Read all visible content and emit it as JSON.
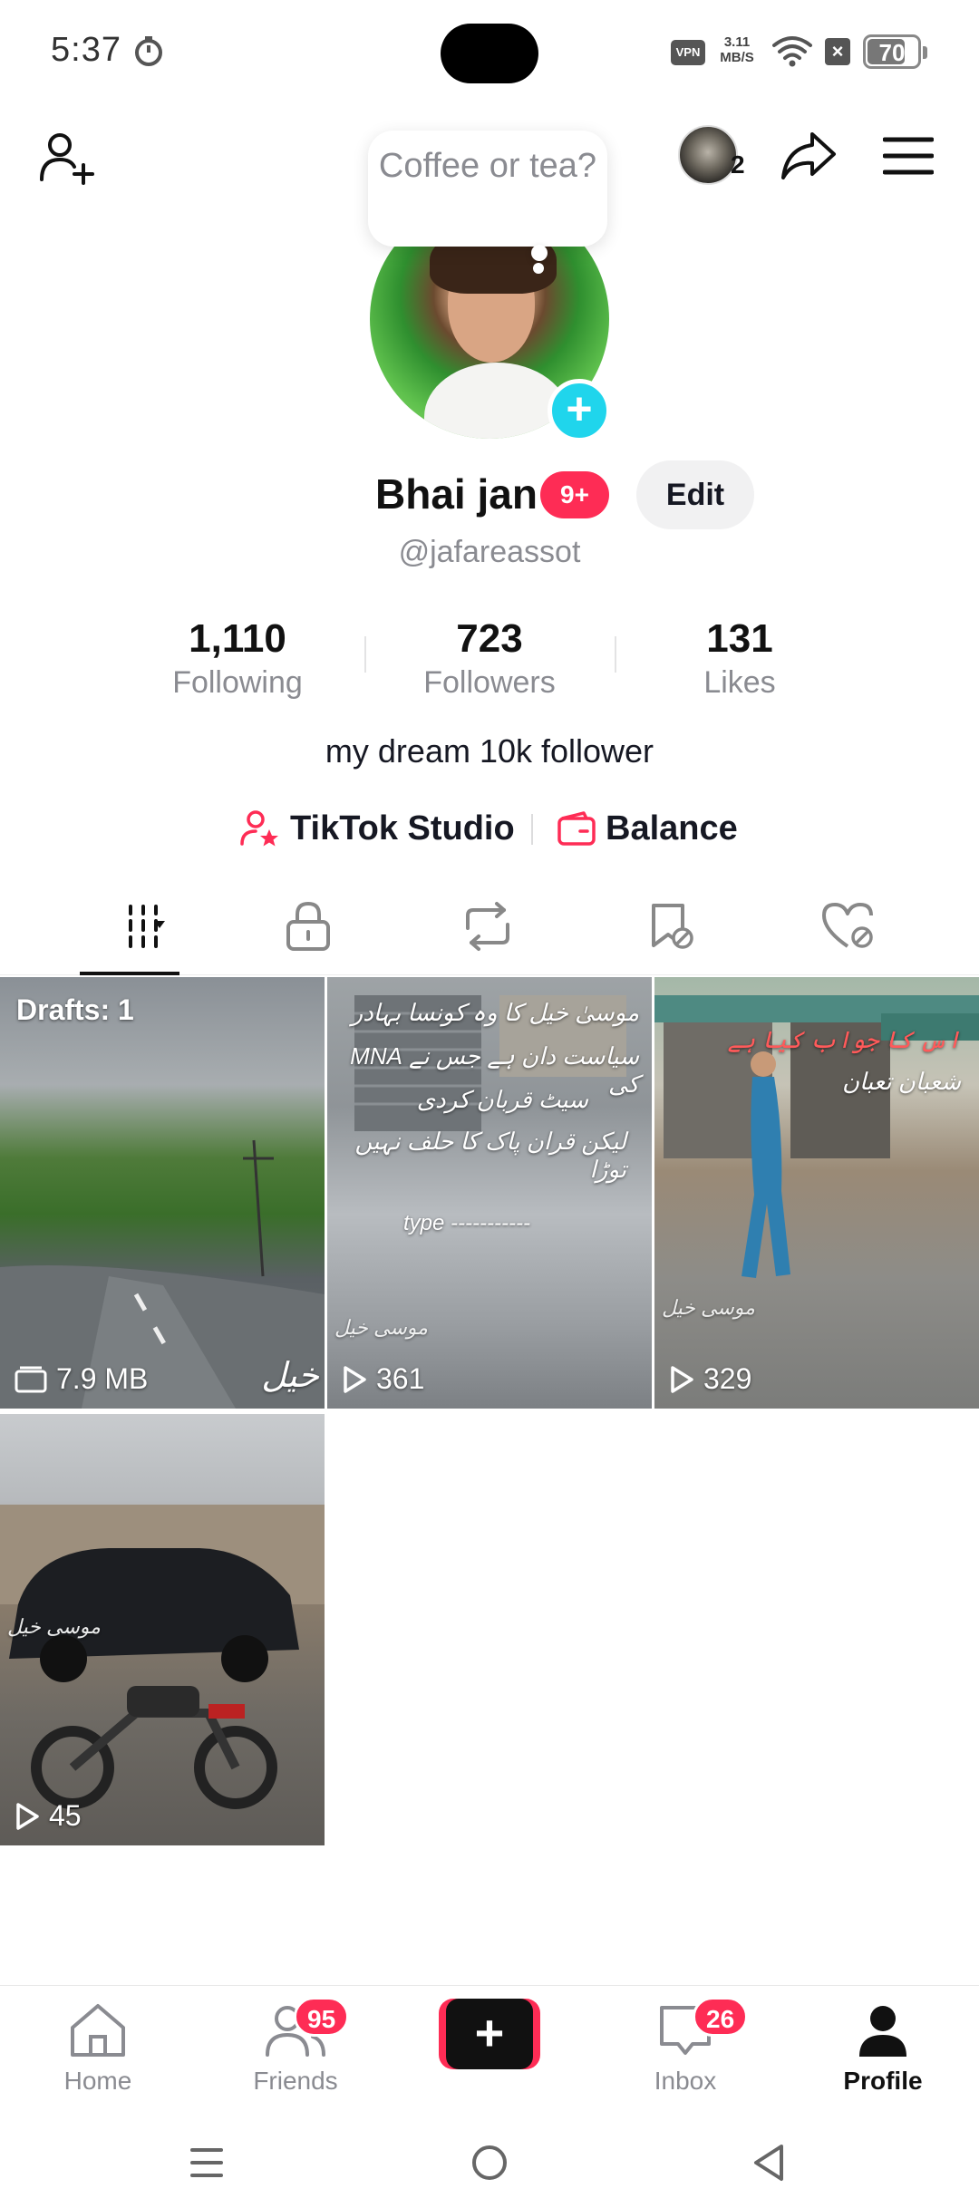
{
  "status_bar": {
    "time": "5:37",
    "vpn": "VPN",
    "net_speed_value": "3.11",
    "net_speed_unit": "MB/S",
    "battery": "70"
  },
  "header": {
    "account_count": "2",
    "note_text": "Coffee or tea?"
  },
  "profile": {
    "display_name": "Bhai jan",
    "notification_badge": "9+",
    "edit_label": "Edit",
    "username": "@jafareassot",
    "bio": "my dream 10k follower"
  },
  "stats": [
    {
      "value": "1,110",
      "label": "Following"
    },
    {
      "value": "723",
      "label": "Followers"
    },
    {
      "value": "131",
      "label": "Likes"
    }
  ],
  "links": {
    "studio_label": "TikTok Studio",
    "balance_label": "Balance"
  },
  "tabs": [
    "videos-icon",
    "lock-icon",
    "repost-icon",
    "bookmark-hidden-icon",
    "liked-hidden-icon"
  ],
  "grid": {
    "tiles": [
      {
        "top_label": "Drafts: 1",
        "bottom": "7.9 MB",
        "overlay_urdu": "خیل"
      },
      {
        "bottom": "361",
        "overlay_lines": [
          "موسیٰ خیل کا وہ کونسا بہادر",
          "سیاست دان ہے جس نے MNA کی",
          "سیٹ قربان کردی",
          "لیکن قران پاک کا حلف نہیں توڑا"
        ],
        "caption": "type -----------",
        "watermark": "موسی خیل"
      },
      {
        "bottom": "329",
        "overlay_lines": [
          "اس کا جواب کیا ہے",
          "شعبان تعبان"
        ],
        "watermark": "موسی خیل"
      },
      {
        "bottom": "45",
        "watermark": "موسی خیل"
      }
    ]
  },
  "bottom_nav": {
    "home": "Home",
    "friends": "Friends",
    "friends_badge": "95",
    "inbox": "Inbox",
    "inbox_badge": "26",
    "profile": "Profile",
    "create": "+"
  },
  "colors": {
    "accent": "#fe2c55",
    "cyan": "#25f4ee",
    "muted": "#8a8b91"
  }
}
